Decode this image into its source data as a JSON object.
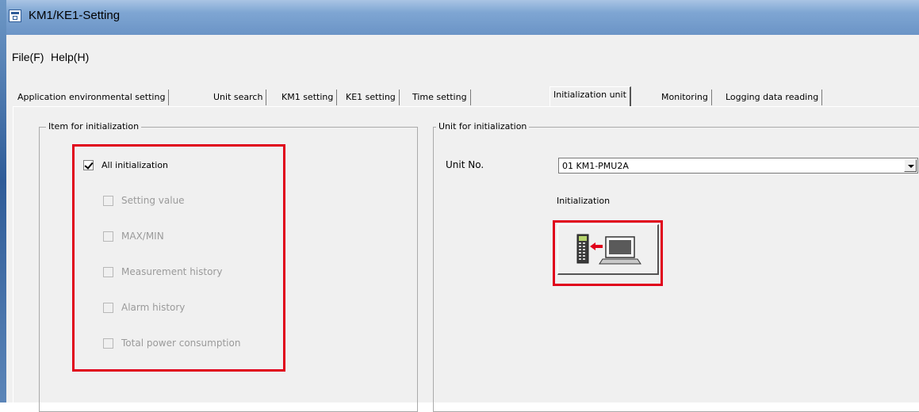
{
  "window": {
    "title": "KM1/KE1-Setting",
    "icon": "window-app-icon"
  },
  "menu": {
    "items": [
      "File(F)",
      "Help(H)"
    ]
  },
  "tabs": [
    {
      "label": "Application environmental setting",
      "active": false
    },
    {
      "label": "Unit search",
      "active": false
    },
    {
      "label": "KM1 setting",
      "active": false
    },
    {
      "label": "KE1 setting",
      "active": false
    },
    {
      "label": "Time setting",
      "active": false
    },
    {
      "label": "Initialization unit",
      "active": true
    },
    {
      "label": "Monitoring",
      "active": false
    },
    {
      "label": "Logging data reading",
      "active": false
    }
  ],
  "items_group": {
    "title": "Item for initialization",
    "options": [
      {
        "label": "All initialization",
        "checked": true,
        "enabled": true
      },
      {
        "label": "Setting value",
        "checked": false,
        "enabled": false
      },
      {
        "label": "MAX/MIN",
        "checked": false,
        "enabled": false
      },
      {
        "label": "Measurement history",
        "checked": false,
        "enabled": false
      },
      {
        "label": "Alarm history",
        "checked": false,
        "enabled": false
      },
      {
        "label": "Total power consumption",
        "checked": false,
        "enabled": false
      }
    ]
  },
  "unit_group": {
    "title": "Unit for initialization",
    "unit_no_label": "Unit No.",
    "unit_no_value": "01 KM1-PMU2A",
    "initialization_label": "Initialization",
    "initialization_button_icon": "unit-to-pc-transfer-icon"
  },
  "colors": {
    "highlight": "#e0001b",
    "titlebar": "#7fa6d3"
  }
}
